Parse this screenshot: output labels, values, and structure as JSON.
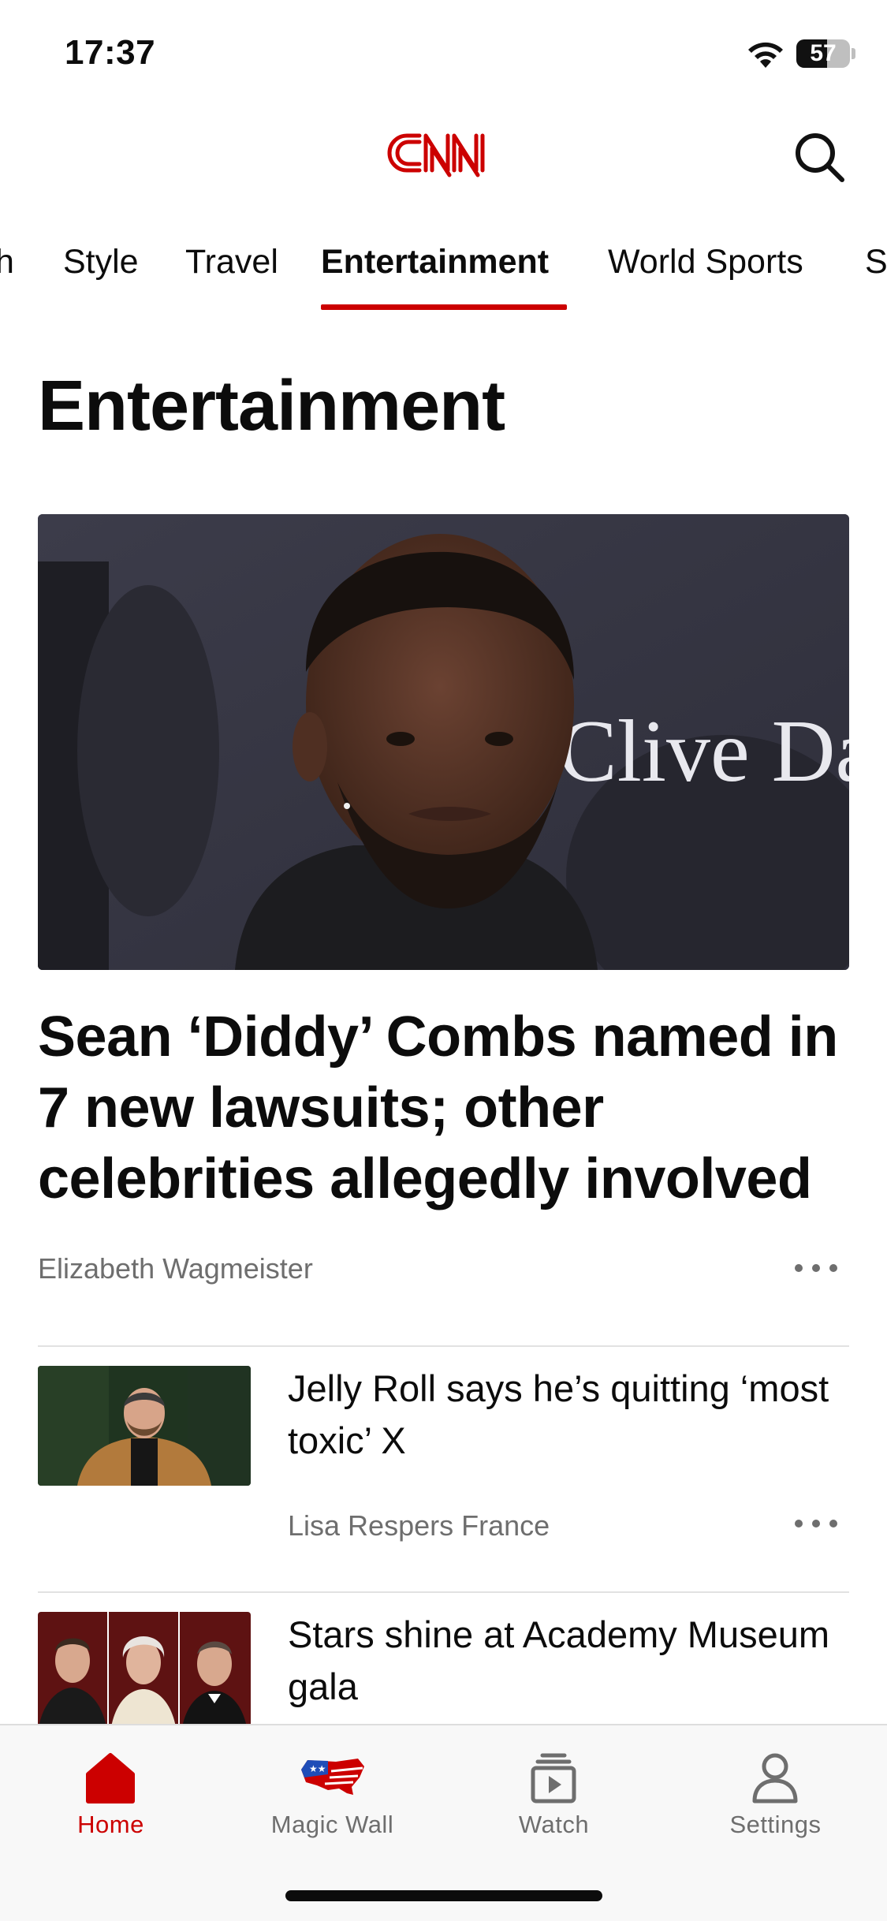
{
  "status_bar": {
    "time": "17:37",
    "battery_percent": "57",
    "battery_level": 0.57
  },
  "header": {
    "logo_text": "CNN",
    "brand_color": "#cc0000",
    "search_icon": "search-icon"
  },
  "section_nav": {
    "items": [
      {
        "label": "h"
      },
      {
        "label": "Style"
      },
      {
        "label": "Travel"
      },
      {
        "label": "Entertainment",
        "active": true
      },
      {
        "label": "World Sports"
      },
      {
        "label": "S"
      }
    ]
  },
  "page": {
    "title": "Entertainment"
  },
  "hero": {
    "headline": "Sean ‘Diddy’ Combs named in 7 new lawsuits; other celebrities allegedly involved",
    "byline": "Elizabeth Wagmeister",
    "backdrop_text": "Clive Da"
  },
  "stories": [
    {
      "title": "Jelly Roll says he’s quitting ‘most toxic’ X",
      "byline": "Lisa Respers France"
    },
    {
      "title": "Stars shine at Academy Museum gala",
      "byline": ""
    }
  ],
  "tab_bar": {
    "tabs": [
      {
        "label": "Home",
        "icon": "home-icon",
        "active": true
      },
      {
        "label": "Magic Wall",
        "icon": "us-map-icon"
      },
      {
        "label": "Watch",
        "icon": "watch-play-icon"
      },
      {
        "label": "Settings",
        "icon": "person-icon"
      }
    ]
  }
}
